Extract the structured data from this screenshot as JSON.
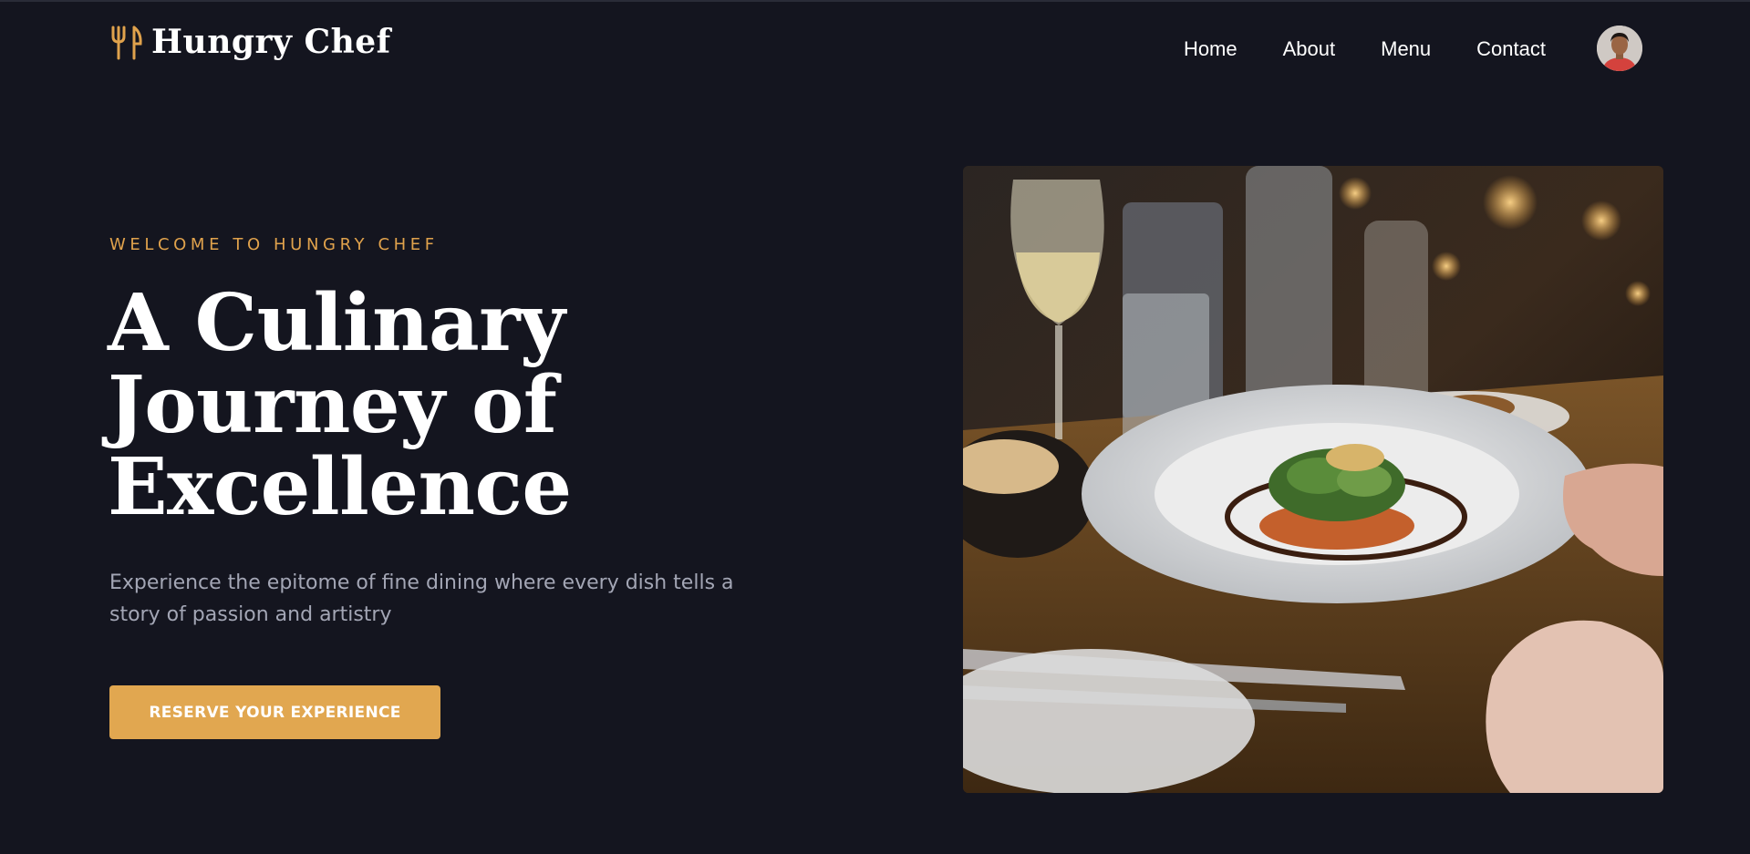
{
  "brand": {
    "name": "Hungry Chef",
    "icon": "fork-knife-icon",
    "accent_color": "#e0a24c"
  },
  "nav": {
    "items": [
      {
        "label": "Home"
      },
      {
        "label": "About"
      },
      {
        "label": "Menu"
      },
      {
        "label": "Contact"
      }
    ],
    "avatar": "user-avatar"
  },
  "hero": {
    "eyebrow": "Welcome to Hungry Chef",
    "title_lines": [
      "A Culinary",
      "Journey of",
      "Excellence"
    ],
    "subtitle": "Experience the epitome of fine dining where every dish tells a story of passion and artistry",
    "cta_label": "Reserve Your Experience",
    "cta_color": "#e1a750",
    "image": "fine-dining-table-photo"
  },
  "colors": {
    "background": "#14151f",
    "text": "#ffffff",
    "muted_text": "#a3a6b5"
  }
}
